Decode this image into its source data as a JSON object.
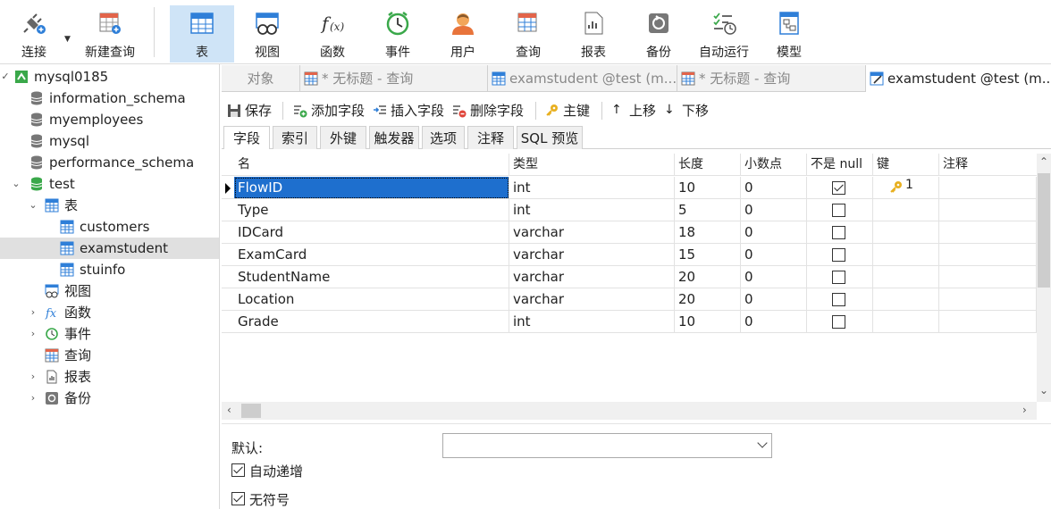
{
  "toolbar": {
    "connect": "连接",
    "new_query": "新建查询",
    "table": "表",
    "view": "视图",
    "function": "函数",
    "event": "事件",
    "user": "用户",
    "query": "查询",
    "report": "报表",
    "backup": "备份",
    "auto_run": "自动运行",
    "model": "模型"
  },
  "sidebar": {
    "connection": "mysql0185",
    "databases": [
      "information_schema",
      "myemployees",
      "mysql",
      "performance_schema"
    ],
    "test_db": "test",
    "tables_label": "表",
    "tables": [
      "customers",
      "examstudent",
      "stuinfo"
    ],
    "views_label": "视图",
    "functions_label": "函数",
    "events_label": "事件",
    "queries_label": "查询",
    "reports_label": "报表",
    "backups_label": "备份"
  },
  "tabs": {
    "objects": "对象",
    "tab1": "* 无标题 - 查询",
    "tab2": "examstudent @test (m...",
    "tab3": "* 无标题 - 查询",
    "tab4": "examstudent @test (m..."
  },
  "subbar": {
    "save": "保存",
    "add_field": "添加字段",
    "insert_field": "插入字段",
    "delete_field": "删除字段",
    "primary_key": "主键",
    "move_up": "上移",
    "move_down": "下移"
  },
  "inner_tabs": [
    "字段",
    "索引",
    "外键",
    "触发器",
    "选项",
    "注释",
    "SQL 预览"
  ],
  "grid": {
    "headers": [
      "名",
      "类型",
      "长度",
      "小数点",
      "不是 null",
      "键",
      "注释"
    ],
    "rows": [
      {
        "name": "FlowID",
        "type": "int",
        "length": "10",
        "decimals": "0",
        "not_null": true,
        "key": "1"
      },
      {
        "name": "Type",
        "type": "int",
        "length": "5",
        "decimals": "0",
        "not_null": false,
        "key": ""
      },
      {
        "name": "IDCard",
        "type": "varchar",
        "length": "18",
        "decimals": "0",
        "not_null": false,
        "key": ""
      },
      {
        "name": "ExamCard",
        "type": "varchar",
        "length": "15",
        "decimals": "0",
        "not_null": false,
        "key": ""
      },
      {
        "name": "StudentName",
        "type": "varchar",
        "length": "20",
        "decimals": "0",
        "not_null": false,
        "key": ""
      },
      {
        "name": "Location",
        "type": "varchar",
        "length": "20",
        "decimals": "0",
        "not_null": false,
        "key": ""
      },
      {
        "name": "Grade",
        "type": "int",
        "length": "10",
        "decimals": "0",
        "not_null": false,
        "key": ""
      }
    ]
  },
  "props": {
    "default_label": "默认:",
    "default_value": "",
    "auto_increment_label": "自动递增",
    "auto_increment": true,
    "unsigned_label": "无符号",
    "unsigned": true
  },
  "colors": {
    "accent": "#1e6fce",
    "active_toolbar": "#cfe4f7",
    "db_green": "#3aa84a"
  }
}
